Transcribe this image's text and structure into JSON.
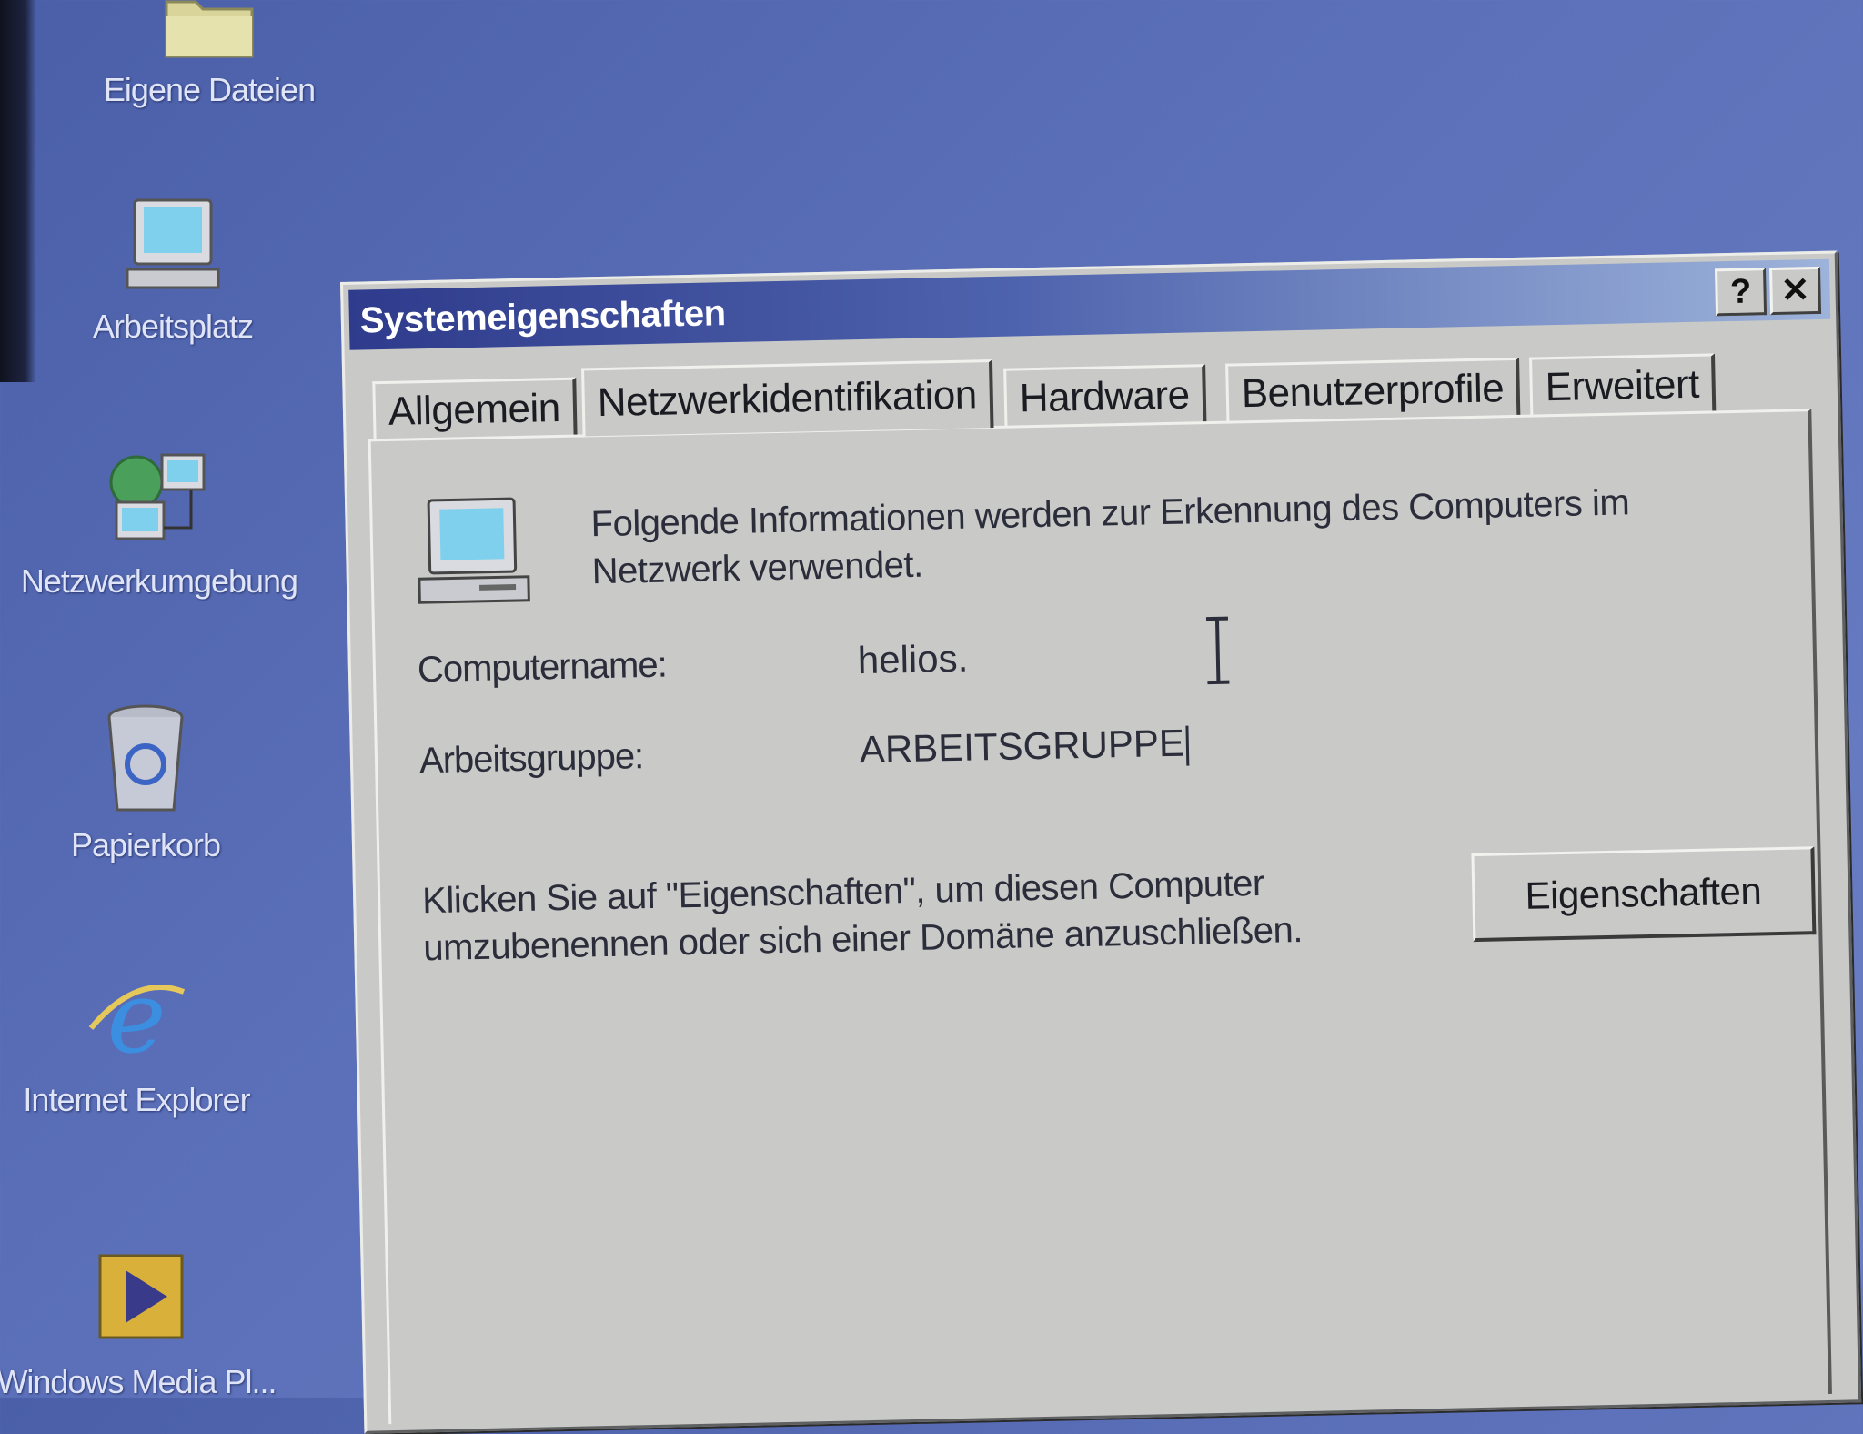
{
  "desktop": {
    "icons": [
      {
        "label": "Eigene Dateien",
        "icon": "folder-icon"
      },
      {
        "label": "Arbeitsplatz",
        "icon": "computer-icon"
      },
      {
        "label": "Netzwerkumgebung",
        "icon": "network-icon"
      },
      {
        "label": "Papierkorb",
        "icon": "recycle-bin-icon"
      },
      {
        "label": "Internet Explorer",
        "icon": "internet-explorer-icon"
      },
      {
        "label": "Windows Media Pl...",
        "icon": "media-player-icon"
      }
    ]
  },
  "dialog": {
    "title": "Systemeigenschaften",
    "help_button": "?",
    "close_button": "✕",
    "tabs": [
      {
        "label": "Allgemein",
        "active": false
      },
      {
        "label": "Netzwerkidentifikation",
        "active": true
      },
      {
        "label": "Hardware",
        "active": false
      },
      {
        "label": "Benutzerprofile",
        "active": false
      },
      {
        "label": "Erweitert",
        "active": false
      }
    ],
    "info_text": "Folgende Informationen werden zur Erkennung des Computers im Netzwerk verwendet.",
    "computer_name_label": "Computername:",
    "computer_name_value": "helios.",
    "workgroup_label": "Arbeitsgruppe:",
    "workgroup_value": "ARBEITSGRUPPE",
    "hint_text": "Klicken Sie auf \"Eigenschaften\", um diesen Computer umzubenennen oder sich einer Domäne anzuschließen.",
    "properties_button": "Eigenschaften"
  },
  "colors": {
    "desktop": "#5a6fb8",
    "titlebar_start": "#2f3b8c",
    "titlebar_end": "#9db3da",
    "dialog_face": "#c9cac8"
  }
}
